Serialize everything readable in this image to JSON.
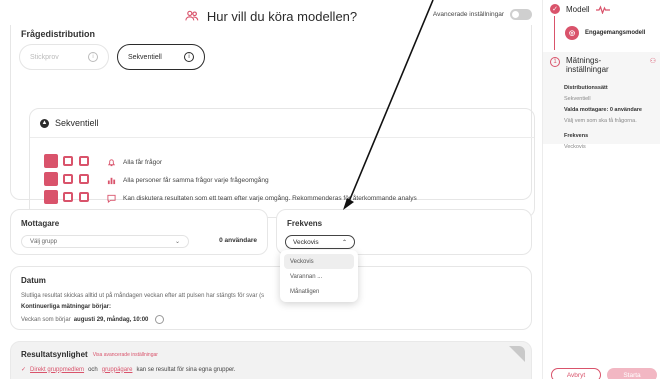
{
  "header": {
    "title": "Hur vill du köra modellen?",
    "advanced_label": "Avancerade inställningar"
  },
  "distribution": {
    "label": "Frågedistribution",
    "options": [
      {
        "label": "Stickprov"
      },
      {
        "label": "Sekventiell"
      }
    ],
    "selected": "Sekventiell",
    "sequential": {
      "heading": "Sekventiell",
      "features": [
        "Alla får frågor",
        "Alla personer får samma frågor varje frågeomgång",
        "Kan diskutera resultaten som ett team efter varje omgång. Rekommenderas för återkommande analys"
      ]
    }
  },
  "recipients": {
    "title": "Mottagare",
    "placeholder": "Välj grupp",
    "users": "0 användare"
  },
  "frequency": {
    "title": "Frekvens",
    "selected": "Veckovis",
    "options": [
      "Veckovis",
      "Varannan ...",
      "Månatligen"
    ]
  },
  "datum": {
    "title": "Datum",
    "line1": "Slutliga resultat skickas alltid ut på måndagen veckan efter att pulsen har stängts för svar (s",
    "line2": "Kontinuerliga mätningar börjar:",
    "line3_prefix": "Veckan som börjar",
    "line3_value": "augusti 29, måndag, 10:00"
  },
  "results": {
    "title": "Resultatsynlighet",
    "link": "Visa avancerade inställningar",
    "line_link1": "Direkt gruppmedlem",
    "line_and": "och",
    "line_link2": "gruppägare",
    "line_rest": "kan se resultat för sina egna grupper."
  },
  "sidebar": {
    "step1": "Modell",
    "model_name": "Engagemangsmodell",
    "step2_num": "1",
    "step2": "Mätnings-\ninställningar",
    "details": {
      "dist_label": "Distributionssätt",
      "dist_value": "Sekventiell",
      "recipients_label": "Valda mottagare: 0 användare",
      "recipients_hint": "Välj vem som ska få frågorna.",
      "freq_label": "Frekvens",
      "freq_value": "Veckovis"
    },
    "cancel": "Avbryt",
    "start": "Starta"
  },
  "colors": {
    "accent": "#d9536b"
  }
}
